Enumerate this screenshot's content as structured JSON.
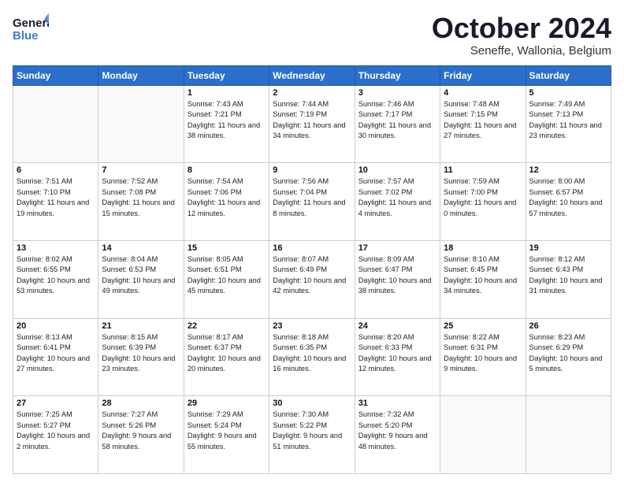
{
  "header": {
    "logo_general": "General",
    "logo_blue": "Blue",
    "month_title": "October 2024",
    "location": "Seneffe, Wallonia, Belgium"
  },
  "weekdays": [
    "Sunday",
    "Monday",
    "Tuesday",
    "Wednesday",
    "Thursday",
    "Friday",
    "Saturday"
  ],
  "weeks": [
    [
      {
        "day": "",
        "empty": true
      },
      {
        "day": "",
        "empty": true
      },
      {
        "day": "1",
        "sunrise": "7:43 AM",
        "sunset": "7:21 PM",
        "daylight": "11 hours and 38 minutes."
      },
      {
        "day": "2",
        "sunrise": "7:44 AM",
        "sunset": "7:19 PM",
        "daylight": "11 hours and 34 minutes."
      },
      {
        "day": "3",
        "sunrise": "7:46 AM",
        "sunset": "7:17 PM",
        "daylight": "11 hours and 30 minutes."
      },
      {
        "day": "4",
        "sunrise": "7:48 AM",
        "sunset": "7:15 PM",
        "daylight": "11 hours and 27 minutes."
      },
      {
        "day": "5",
        "sunrise": "7:49 AM",
        "sunset": "7:13 PM",
        "daylight": "11 hours and 23 minutes."
      }
    ],
    [
      {
        "day": "6",
        "sunrise": "7:51 AM",
        "sunset": "7:10 PM",
        "daylight": "11 hours and 19 minutes."
      },
      {
        "day": "7",
        "sunrise": "7:52 AM",
        "sunset": "7:08 PM",
        "daylight": "11 hours and 15 minutes."
      },
      {
        "day": "8",
        "sunrise": "7:54 AM",
        "sunset": "7:06 PM",
        "daylight": "11 hours and 12 minutes."
      },
      {
        "day": "9",
        "sunrise": "7:56 AM",
        "sunset": "7:04 PM",
        "daylight": "11 hours and 8 minutes."
      },
      {
        "day": "10",
        "sunrise": "7:57 AM",
        "sunset": "7:02 PM",
        "daylight": "11 hours and 4 minutes."
      },
      {
        "day": "11",
        "sunrise": "7:59 AM",
        "sunset": "7:00 PM",
        "daylight": "11 hours and 0 minutes."
      },
      {
        "day": "12",
        "sunrise": "8:00 AM",
        "sunset": "6:57 PM",
        "daylight": "10 hours and 57 minutes."
      }
    ],
    [
      {
        "day": "13",
        "sunrise": "8:02 AM",
        "sunset": "6:55 PM",
        "daylight": "10 hours and 53 minutes."
      },
      {
        "day": "14",
        "sunrise": "8:04 AM",
        "sunset": "6:53 PM",
        "daylight": "10 hours and 49 minutes."
      },
      {
        "day": "15",
        "sunrise": "8:05 AM",
        "sunset": "6:51 PM",
        "daylight": "10 hours and 45 minutes."
      },
      {
        "day": "16",
        "sunrise": "8:07 AM",
        "sunset": "6:49 PM",
        "daylight": "10 hours and 42 minutes."
      },
      {
        "day": "17",
        "sunrise": "8:09 AM",
        "sunset": "6:47 PM",
        "daylight": "10 hours and 38 minutes."
      },
      {
        "day": "18",
        "sunrise": "8:10 AM",
        "sunset": "6:45 PM",
        "daylight": "10 hours and 34 minutes."
      },
      {
        "day": "19",
        "sunrise": "8:12 AM",
        "sunset": "6:43 PM",
        "daylight": "10 hours and 31 minutes."
      }
    ],
    [
      {
        "day": "20",
        "sunrise": "8:13 AM",
        "sunset": "6:41 PM",
        "daylight": "10 hours and 27 minutes."
      },
      {
        "day": "21",
        "sunrise": "8:15 AM",
        "sunset": "6:39 PM",
        "daylight": "10 hours and 23 minutes."
      },
      {
        "day": "22",
        "sunrise": "8:17 AM",
        "sunset": "6:37 PM",
        "daylight": "10 hours and 20 minutes."
      },
      {
        "day": "23",
        "sunrise": "8:18 AM",
        "sunset": "6:35 PM",
        "daylight": "10 hours and 16 minutes."
      },
      {
        "day": "24",
        "sunrise": "8:20 AM",
        "sunset": "6:33 PM",
        "daylight": "10 hours and 12 minutes."
      },
      {
        "day": "25",
        "sunrise": "8:22 AM",
        "sunset": "6:31 PM",
        "daylight": "10 hours and 9 minutes."
      },
      {
        "day": "26",
        "sunrise": "8:23 AM",
        "sunset": "6:29 PM",
        "daylight": "10 hours and 5 minutes."
      }
    ],
    [
      {
        "day": "27",
        "sunrise": "7:25 AM",
        "sunset": "5:27 PM",
        "daylight": "10 hours and 2 minutes."
      },
      {
        "day": "28",
        "sunrise": "7:27 AM",
        "sunset": "5:26 PM",
        "daylight": "9 hours and 58 minutes."
      },
      {
        "day": "29",
        "sunrise": "7:29 AM",
        "sunset": "5:24 PM",
        "daylight": "9 hours and 55 minutes."
      },
      {
        "day": "30",
        "sunrise": "7:30 AM",
        "sunset": "5:22 PM",
        "daylight": "9 hours and 51 minutes."
      },
      {
        "day": "31",
        "sunrise": "7:32 AM",
        "sunset": "5:20 PM",
        "daylight": "9 hours and 48 minutes."
      },
      {
        "day": "",
        "empty": true
      },
      {
        "day": "",
        "empty": true
      }
    ]
  ],
  "labels": {
    "sunrise_prefix": "Sunrise: ",
    "sunset_prefix": "Sunset: ",
    "daylight_prefix": "Daylight: "
  }
}
